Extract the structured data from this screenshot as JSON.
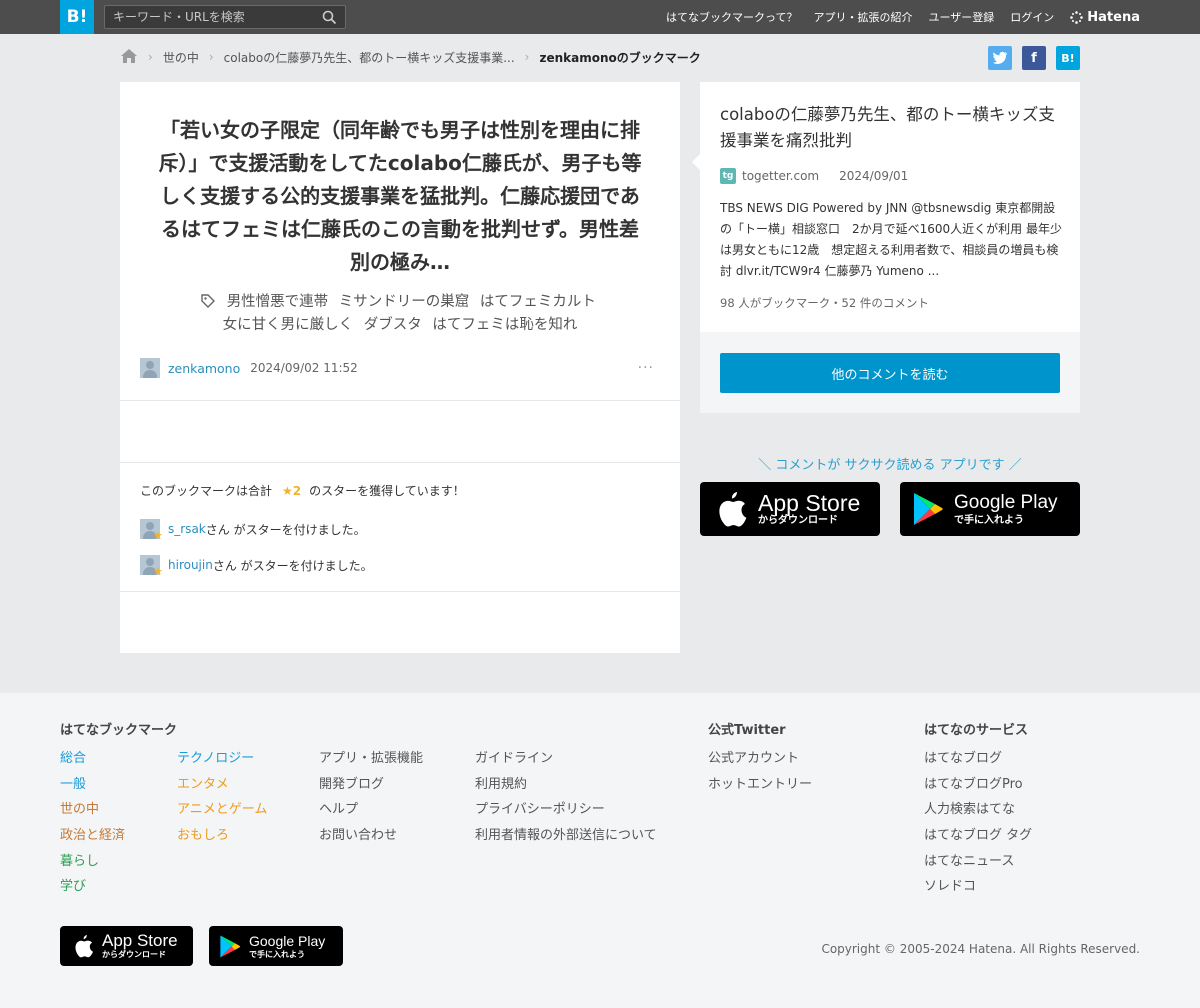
{
  "header": {
    "logo": "B!",
    "search_placeholder": "キーワード・URLを検索",
    "nav": [
      "はてなブックマークって？",
      "アプリ・拡張の紹介",
      "ユーザー登録",
      "ログイン"
    ],
    "brand": "Hatena"
  },
  "breadcrumb": {
    "items": [
      "世の中",
      "colaboの仁藤夢乃先生、都のトー横キッズ支援事業...",
      "zenkamonoのブックマーク"
    ]
  },
  "share": {
    "twitter": "t",
    "facebook": "f",
    "hatena": "B!"
  },
  "bookmark": {
    "comment": "「若い女の子限定（同年齢でも男子は性別を理由に排斥）」で支援活動をしてたcolabo仁藤氏が、男子も等しく支援する公的支援事業を猛批判。仁藤応援団であるはてフェミは仁藤氏のこの言動を批判せず。男性差別の極み…",
    "tags": [
      "男性憎悪で連帯",
      "ミサンドリーの巣窟",
      "はてフェミカルト",
      "女に甘く男に厳しく",
      "ダブスタ",
      "はてフェミは恥を知れ"
    ],
    "user": "zenkamono",
    "timestamp": "2024/09/02 11:52",
    "more": "···"
  },
  "stars": {
    "summary_prefix": "このブックマークは合計",
    "count": "★2",
    "summary_suffix": "のスターを獲得しています！",
    "givers": [
      {
        "name": "s_rsak",
        "text": "さん がスターを付けました。"
      },
      {
        "name": "hiroujin",
        "text": "さん がスターを付けました。"
      }
    ]
  },
  "entry": {
    "title": "colaboの仁藤夢乃先生、都のトー横キッズ支援事業を痛烈批判",
    "domain": "togetter.com",
    "date": "2024/09/01",
    "excerpt": "TBS NEWS DIG Powered by JNN @tbsnewsdig 東京都開設の「トー横」相談窓口　2か月で延べ1600人近くが利用 最年少は男女ともに12歳　想定超える利用者数で、相談員の増員も検討 dlvr.it/TCW9r4 仁藤夢乃 Yumeno ...",
    "count": "98 人がブックマーク・52 件のコメント",
    "read_button": "他のコメントを読む"
  },
  "promo": {
    "text": "＼ コメントが サクサク読める アプリです ／",
    "appstore_big": "App Store",
    "appstore_small": "からダウンロード",
    "googleplay_big": "Google Play",
    "googleplay_small": "で手に入れよう"
  },
  "footer": {
    "heading_bookmark": "はてなブックマーク",
    "categories_col1": [
      "総合",
      "一般",
      "世の中",
      "政治と経済",
      "暮らし",
      "学び"
    ],
    "categories_col2": [
      "テクノロジー",
      "エンタメ",
      "アニメとゲーム",
      "おもしろ"
    ],
    "links_col3": [
      "アプリ・拡張機能",
      "開発ブログ",
      "ヘルプ",
      "お問い合わせ"
    ],
    "links_col4": [
      "ガイドライン",
      "利用規約",
      "プライバシーポリシー",
      "利用者情報の外部送信について"
    ],
    "heading_twitter": "公式Twitter",
    "twitter_links": [
      "公式アカウント",
      "ホットエントリー"
    ],
    "heading_services": "はてなのサービス",
    "services": [
      "はてなブログ",
      "はてなブログPro",
      "人力検索はてな",
      "はてなブログ タグ",
      "はてなニュース",
      "ソレドコ"
    ],
    "copyright": "Copyright © 2005-2024 Hatena. All Rights Reserved."
  },
  "colors": {
    "accent": "#00a4de",
    "button": "#0094cc",
    "link": "#2a8fbd",
    "star": "#f0b42b"
  }
}
